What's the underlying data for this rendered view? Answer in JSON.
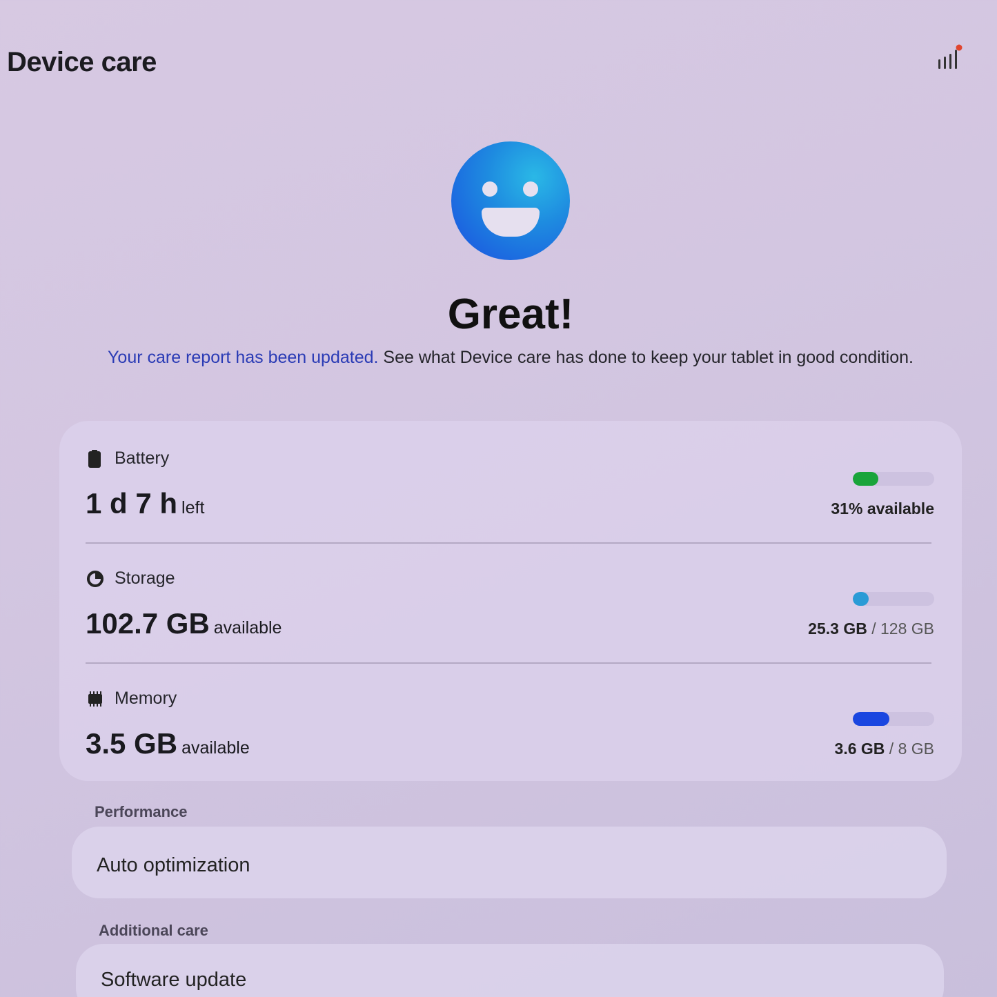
{
  "header": {
    "title": "Device care",
    "report_icon": "bar-chart-icon"
  },
  "status": {
    "icon": "smiley-face-icon",
    "title": "Great!",
    "link_text": "Your care report has been updated.",
    "description": " See what Device care has done to keep your tablet in good condition."
  },
  "battery": {
    "label": "Battery",
    "icon": "battery-icon",
    "value": "1 d 7 h",
    "suffix": "left",
    "percent": 31,
    "right_strong": "31% available",
    "color": "#19a43a"
  },
  "storage": {
    "label": "Storage",
    "icon": "pie-icon",
    "value": "102.7 GB",
    "suffix": "available",
    "used_fraction": 0.198,
    "right_strong": "25.3 GB",
    "right_muted": "/ 128 GB",
    "color": "#2a9bd6"
  },
  "memory": {
    "label": "Memory",
    "icon": "memory-chip-icon",
    "value": "3.5 GB",
    "suffix": "available",
    "used_fraction": 0.45,
    "right_strong": "3.6 GB",
    "right_muted": "/ 8 GB",
    "color": "#1a46e0"
  },
  "performance": {
    "section": "Performance",
    "item": "Auto optimization"
  },
  "additional": {
    "section": "Additional care",
    "item": "Software update"
  }
}
